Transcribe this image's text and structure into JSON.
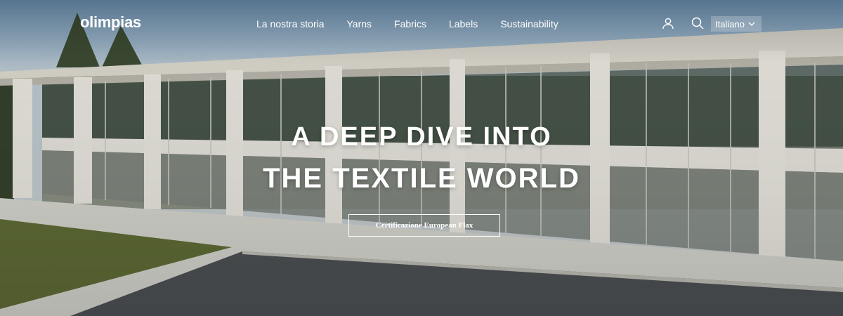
{
  "header": {
    "logo": "olimpias",
    "nav": [
      {
        "label": "La nostra storia"
      },
      {
        "label": "Yarns"
      },
      {
        "label": "Fabrics"
      },
      {
        "label": "Labels"
      },
      {
        "label": "Sustainability"
      }
    ],
    "icons": {
      "account": "user-icon",
      "search": "search-icon",
      "language_chevron": "chevron-down-icon"
    },
    "language": "Italiano"
  },
  "hero": {
    "headline_line1": "A DEEP DIVE INTO",
    "headline_line2": "THE TEXTILE WORLD",
    "cta_label": "Certificazione European Flax"
  },
  "colors": {
    "text": "#ffffff",
    "sky": "#6f96b8",
    "concrete": "#d8d8d2",
    "lawn": "#5f6b36"
  }
}
